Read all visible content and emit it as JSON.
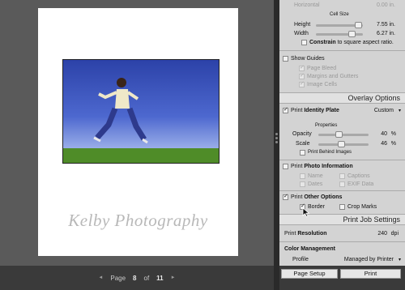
{
  "preview": {
    "identity_plate": "Kelby Photography"
  },
  "pagenav": {
    "prev_glyph": "◄",
    "page_label": "Page",
    "page_number": "8",
    "of_label": "of",
    "page_count": "11",
    "next_glyph": "►"
  },
  "panel": {
    "horizontal_label": "Horizontal",
    "horizontal_value": "0.00 in.",
    "cell_size_label": "Cell Size",
    "height_label": "Height",
    "height_value": "7.55 in.",
    "width_label": "Width",
    "width_value": "6.27 in.",
    "constrain_bold": "Constrain",
    "constrain_rest": " to square aspect ratio.",
    "show_guides_label": "Show Guides",
    "page_bleed_label": "Page Bleed",
    "margins_gutters_label": "Margins and Gutters",
    "image_cells_label": "Image Cells",
    "overlay_header": "Overlay Options",
    "print_identity_plain": "Print ",
    "print_identity_bold": "Identity Plate",
    "identity_dropdown": "Custom",
    "properties_label": "Properties",
    "opacity_label": "Opacity",
    "opacity_value": "40",
    "opacity_unit": "%",
    "scale_label": "Scale",
    "scale_value": "46",
    "scale_unit": "%",
    "print_behind_label": "Print Behind Images",
    "print_photo_info_plain": "Print ",
    "print_photo_info_bold": "Photo Information",
    "name_label": "Name",
    "captions_label": "Captions",
    "dates_label": "Dates",
    "exif_label": "EXIF Data",
    "print_other_plain": "Print ",
    "print_other_bold": "Other Options",
    "border_label": "Border",
    "crop_marks_label": "Crop Marks",
    "job_header": "Print Job Settings",
    "print_resolution_plain": "Print ",
    "print_resolution_bold": "Resolution",
    "resolution_value": "240",
    "resolution_unit": "dpi",
    "color_mgmt_label": "Color Management",
    "profile_label": "Profile",
    "profile_value": "Managed by Printer"
  },
  "buttons": {
    "page_setup": "Page Setup",
    "print": "Print"
  },
  "levels": {
    "opacity_pct": 40,
    "scale_pct": 46
  }
}
